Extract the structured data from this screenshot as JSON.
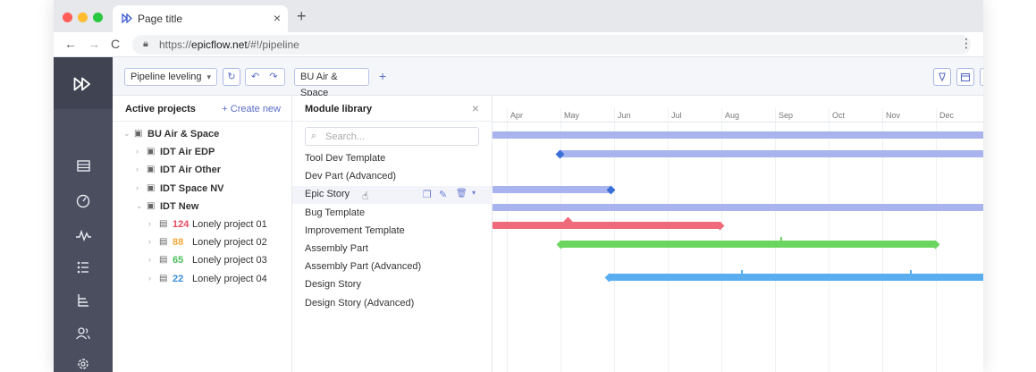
{
  "browser": {
    "tab_title": "Page title",
    "tab_close": "×",
    "new_tab": "+",
    "url_prefix": "https://",
    "url_host": "epicflow.net",
    "url_path": "/#!/pipeline",
    "back": "←",
    "forward": "→",
    "reload": "C",
    "menu": "⋮",
    "dot_colors": [
      "#ff5f57",
      "#febc2e",
      "#28c840"
    ]
  },
  "toolbar": {
    "view_select": "Pipeline leveling",
    "view_caret": "▾",
    "refresh": "↻",
    "undo": "↶",
    "redo": "↷",
    "filter_chip": "BU Air & Space",
    "add": "+",
    "right_icons": [
      "pin-icon",
      "calendar-icon",
      "export-icon",
      "settings-icon"
    ]
  },
  "active_projects": {
    "title": "Active projects",
    "create": "+ Create new",
    "tree": [
      {
        "caret": "⌄",
        "label": "BU Air & Space",
        "bold": true,
        "level": 0
      },
      {
        "caret": "›",
        "label": "IDT Air EDP",
        "bold": true,
        "level": 1
      },
      {
        "caret": "›",
        "label": "IDT Air Other",
        "bold": true,
        "level": 1
      },
      {
        "caret": "›",
        "label": "IDT Space NV",
        "bold": true,
        "level": 1
      },
      {
        "caret": "⌄",
        "label": "IDT New",
        "bold": true,
        "level": 1
      },
      {
        "caret": "›",
        "num": "124",
        "num_color": "#e84b5f",
        "label": "Lonely project 01",
        "level": 2
      },
      {
        "caret": "›",
        "num": "88",
        "num_color": "#f2a93b",
        "label": "Lonely project 02",
        "level": 2
      },
      {
        "caret": "›",
        "num": "65",
        "num_color": "#4bbf5a",
        "label": "Lonely project 03",
        "level": 2
      },
      {
        "caret": "›",
        "num": "22",
        "num_color": "#3a8fd8",
        "label": "Lonely project 04",
        "level": 2
      }
    ]
  },
  "module_library": {
    "title": "Module library",
    "close": "×",
    "search_placeholder": "Search...",
    "items": [
      "Tool Dev Template",
      "Dev Part (Advanced)",
      "Epic Story",
      "Bug Template",
      "Improvement Template",
      "Assembly Part",
      "Assembly Part (Advanced)",
      "Design Story",
      "Design Story (Advanced)"
    ]
  },
  "gantt": {
    "months": [
      "Apr",
      "May",
      "Jun",
      "Jul",
      "Aug",
      "Sep",
      "Oct",
      "Nov",
      "Dec"
    ],
    "colors": {
      "lavender": "#a9b3ee",
      "red": "#ef6b7b",
      "green": "#6ad65f",
      "blue": "#5aaef0",
      "marker_blue": "#3a6fd8"
    }
  }
}
